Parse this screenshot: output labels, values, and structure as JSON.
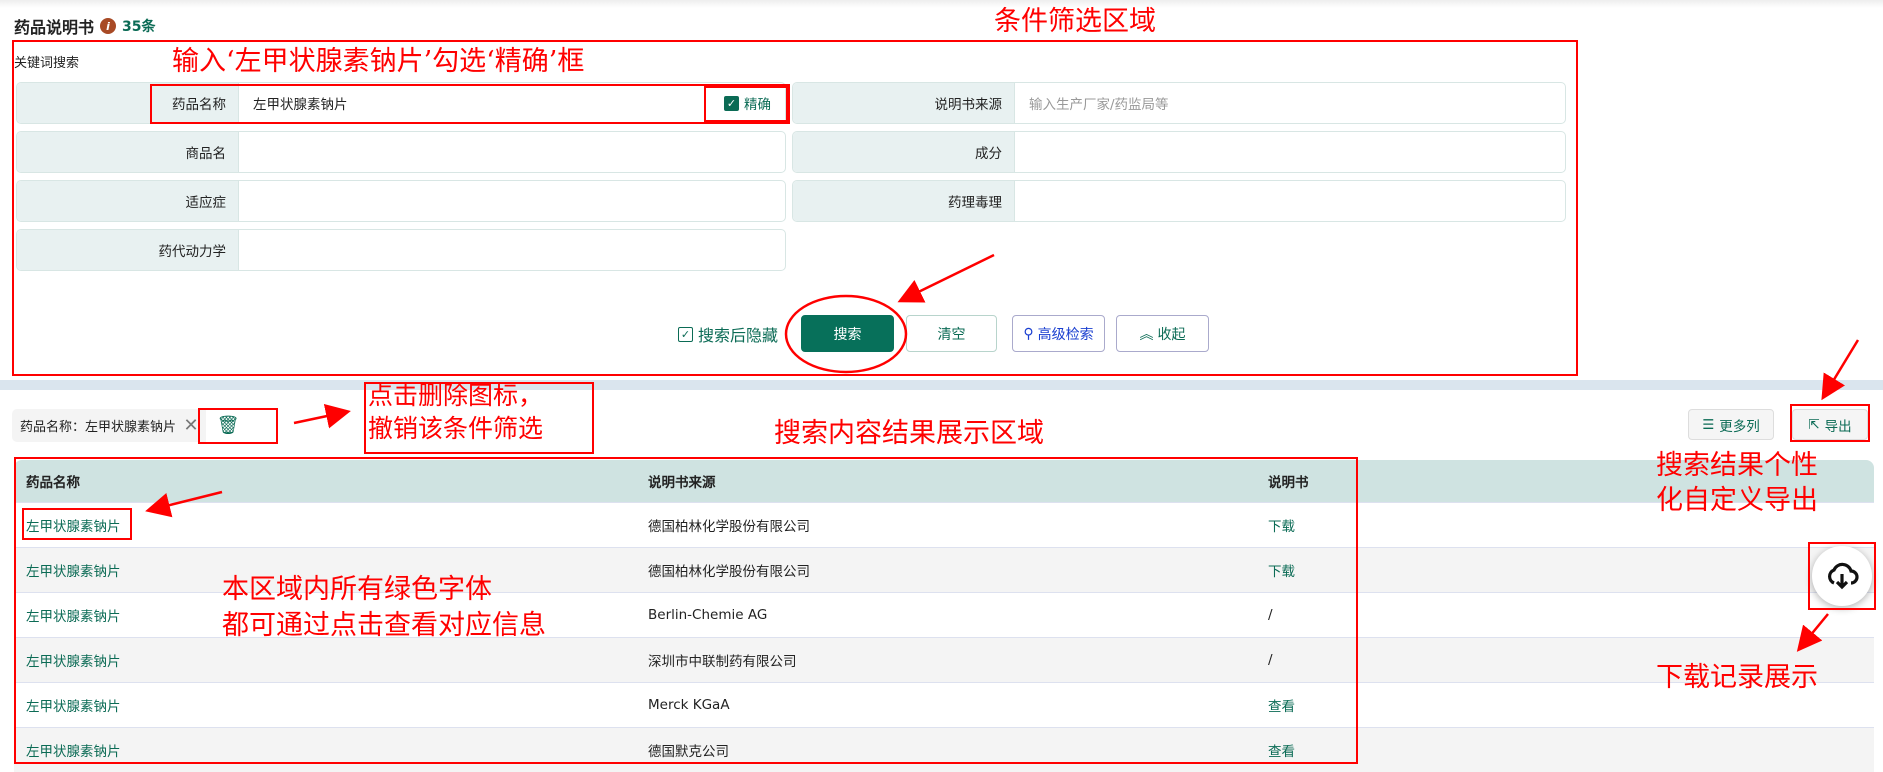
{
  "header": {
    "title": "药品说明书",
    "info_icon": "i",
    "count": "35条"
  },
  "search": {
    "section_label": "关键词搜索",
    "fields": [
      {
        "label": "药品名称",
        "value": "左甲状腺素钠片",
        "exact_label": "精确",
        "exact_checked": true
      },
      {
        "label": "说明书来源",
        "placeholder": "输入生产厂家/药监局等"
      },
      {
        "label": "商品名",
        "value": ""
      },
      {
        "label": "成分",
        "value": ""
      },
      {
        "label": "适应症",
        "value": ""
      },
      {
        "label": "药理毒理",
        "value": ""
      },
      {
        "label": "药代动力学",
        "value": ""
      }
    ],
    "hide_after_search": "搜索后隐藏",
    "search_btn": "搜索",
    "clear_btn": "清空",
    "advanced_btn": "高级检索",
    "collapse_btn": "收起"
  },
  "filter_chip": {
    "text": "药品名称：左甲状腺素钠片"
  },
  "toolbar": {
    "more_columns": "更多列",
    "export": "导出"
  },
  "table": {
    "headers": [
      "药品名称",
      "说明书来源",
      "说明书"
    ],
    "rows": [
      [
        "左甲状腺素钠片",
        "德国柏林化学股份有限公司",
        "下载"
      ],
      [
        "左甲状腺素钠片",
        "德国柏林化学股份有限公司",
        "下载"
      ],
      [
        "左甲状腺素钠片",
        "Berlin-Chemie AG",
        "/"
      ],
      [
        "左甲状腺素钠片",
        "深圳市中联制药有限公司",
        "/"
      ],
      [
        "左甲状腺素钠片",
        "Merck KGaA",
        "查看"
      ],
      [
        "左甲状腺素钠片",
        "德国默克公司",
        "查看"
      ]
    ]
  },
  "annotations": {
    "filter_area": "条件筛选区域",
    "input_hint": "输入‘左甲状腺素钠片’勾选‘精确’框",
    "delete_hint": "点击删除图标，\n撤销该条件筛选",
    "results_area": "搜索内容结果展示区域",
    "green_hint": "本区域内所有绿色字体\n都可通过点击查看对应信息",
    "export_hint": "搜索结果个性\n化自定义导出",
    "download_hint": "下载记录展示"
  },
  "colors": {
    "accent": "#0b6b55",
    "annotation": "#ff0000"
  }
}
